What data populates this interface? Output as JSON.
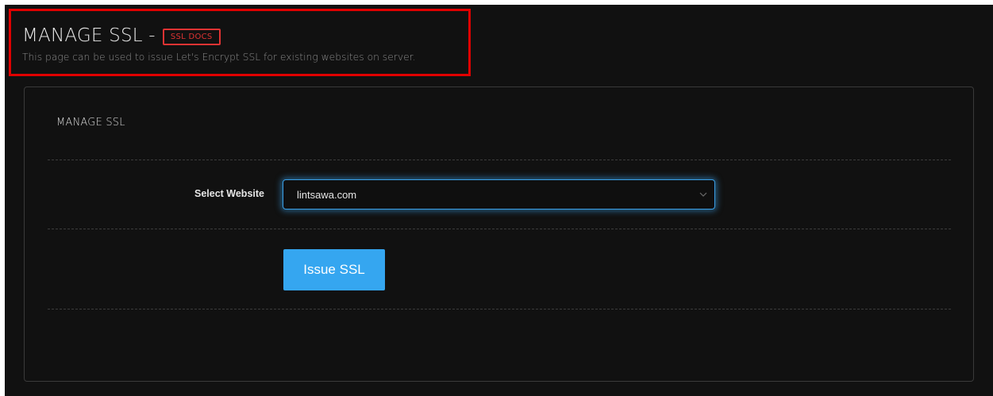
{
  "header": {
    "title": "MANAGE SSL -",
    "docs_label": "SSL DOCS",
    "description": "This page can be used to issue Let's Encrypt SSL for existing websites on server."
  },
  "panel": {
    "title": "MANAGE SSL",
    "form": {
      "website_label": "Select Website",
      "website_selected": "lintsawa.com",
      "submit_label": "Issue SSL"
    }
  },
  "colors": {
    "background": "#111111",
    "highlight": "#e00000",
    "docs_badge": "#e03333",
    "primary_button": "#35a6f0",
    "select_focus": "#3aa0e8"
  },
  "icons": {
    "select_chevron": "chevron-down-icon"
  }
}
